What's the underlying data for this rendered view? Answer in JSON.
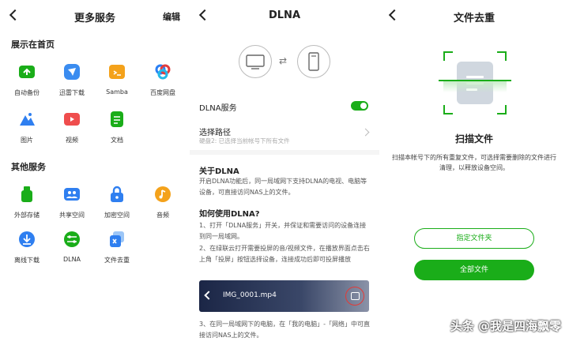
{
  "more_services": {
    "title": "更多服务",
    "edit": "编辑",
    "section_home": "展示在首页",
    "home_items": [
      {
        "label": "自动备份",
        "icon": "auto-backup-icon"
      },
      {
        "label": "迅雷下载",
        "icon": "thunder-download-icon"
      },
      {
        "label": "Samba",
        "icon": "samba-icon"
      },
      {
        "label": "百度网盘",
        "icon": "baidu-netdisk-icon"
      },
      {
        "label": "图片",
        "icon": "photos-icon"
      },
      {
        "label": "视频",
        "icon": "video-icon"
      },
      {
        "label": "文档",
        "icon": "document-icon"
      }
    ],
    "section_other": "其他服务",
    "other_items": [
      {
        "label": "外部存储",
        "icon": "external-storage-icon"
      },
      {
        "label": "共享空间",
        "icon": "shared-space-icon"
      },
      {
        "label": "加密空间",
        "icon": "encrypted-space-icon"
      },
      {
        "label": "音频",
        "icon": "audio-icon"
      },
      {
        "label": "离线下载",
        "icon": "offline-download-icon"
      },
      {
        "label": "DLNA",
        "icon": "dlna-icon"
      },
      {
        "label": "文件去重",
        "icon": "dedupe-icon"
      }
    ]
  },
  "dlna": {
    "title": "DLNA",
    "service_label": "DLNA服务",
    "service_on": true,
    "path_label": "选择路径",
    "path_sub": "硬盘2: 已选择当前帐号下所有文件",
    "about_title": "关于DLNA",
    "about_text": "开启DLNA功能后，同一局域网下支持DLNA的电视、电脑等设备，可直接访问NAS上的文件。",
    "howto_title": "如何使用DLNA?",
    "step1": "1、打开「DLNA服务」开关，并保证和需要访问的设备连接到同一局域网。",
    "step2": "2、在绿联云打开需要投屏的音/视频文件，在播放界面点击右上角「投屏」按钮选择设备，连接成功后即可投屏播放",
    "video_name": "IMG_0001.mp4",
    "step3": "3、在同一局域网下的电脑，在「我的电脑」-「网络」中可直接访问NAS上的文件。"
  },
  "dedupe": {
    "title": "文件去重",
    "heading": "扫描文件",
    "desc": "扫描本帐号下的所有重复文件，可选择需要删除的文件进行清理，以释放设备空间。",
    "btn_folder": "指定文件夹",
    "btn_all": "全部文件",
    "watermark": "头条 @我是四海飘零"
  },
  "colors": {
    "accent": "#1aad19"
  }
}
